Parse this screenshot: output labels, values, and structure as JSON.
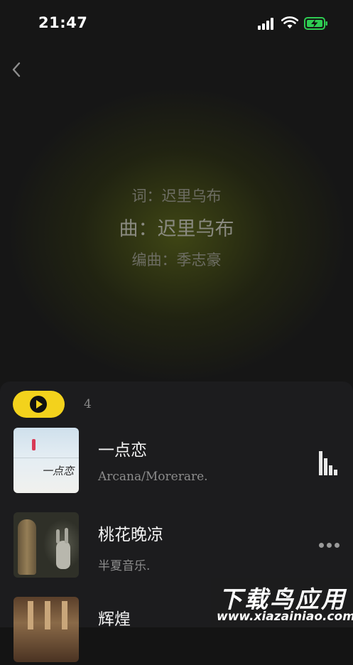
{
  "status_bar": {
    "time": "21:47"
  },
  "credits": {
    "lyricist": "词：迟里乌布",
    "composer": "曲：迟里乌布",
    "arranger": "编曲：季志豪"
  },
  "playlist": {
    "count": "4",
    "songs": [
      {
        "title": "一点恋",
        "artist": "Arcana/Morerare.",
        "cover_text": "一点恋",
        "playing": true
      },
      {
        "title": "桃花晚凉",
        "artist": "半夏音乐.",
        "playing": false
      },
      {
        "title": "辉煌",
        "playing": false
      }
    ]
  },
  "watermark": {
    "cn": "下载鸟应用",
    "en": "www.xiazainiao.com"
  },
  "colors": {
    "accent": "#f3d21c",
    "sheet": "#1c1c1e"
  }
}
